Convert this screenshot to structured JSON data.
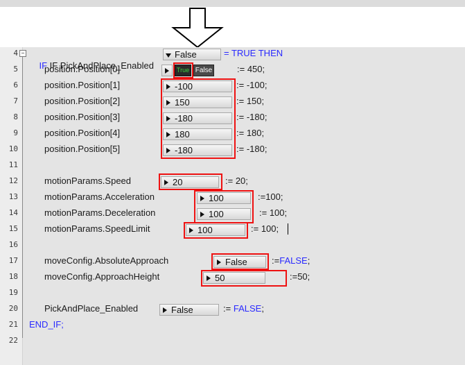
{
  "arrow_icon": "down-arrow-icon",
  "line_numbers": [
    "4",
    "5",
    "6",
    "7",
    "8",
    "9",
    "10",
    "11",
    "12",
    "13",
    "14",
    "15",
    "16",
    "17",
    "18",
    "19",
    "20",
    "21",
    "22"
  ],
  "lines": {
    "l4": {
      "pre": "IF PickAndPlace_Enabled",
      "value": "False",
      "post": "= TRUE THEN"
    },
    "l5": {
      "pre": "position.Position[0]",
      "true_label": "True",
      "false_label": "False",
      "post": ":= 450;"
    },
    "l6": {
      "pre": "position.Position[1]",
      "value": "-100",
      "post": ":= -100;"
    },
    "l7": {
      "pre": "position.Position[2]",
      "value": "150",
      "post": ":= 150;"
    },
    "l8": {
      "pre": "position.Position[3]",
      "value": "-180",
      "post": ":= -180;"
    },
    "l9": {
      "pre": "position.Position[4]",
      "value": "180",
      "post": ":= 180;"
    },
    "l10": {
      "pre": "position.Position[5]",
      "value": "-180",
      "post": ":= -180;"
    },
    "l12": {
      "pre": "motionParams.Speed",
      "value": "20",
      "post": ":= 20;"
    },
    "l13": {
      "pre": "motionParams.Acceleration",
      "value": "100",
      "post": ":=100;"
    },
    "l14": {
      "pre": "motionParams.Deceleration",
      "value": "100",
      "post": ":= 100;"
    },
    "l15": {
      "pre": "motionParams.SpeedLimit",
      "value": "100",
      "post": ":= 100;"
    },
    "l17": {
      "pre": "moveConfig.AbsoluteApproach",
      "value": "False",
      "post_op": ":=",
      "post_kw": "FALSE",
      "post_end": ";"
    },
    "l18": {
      "pre": "moveConfig.ApproachHeight",
      "value": "50",
      "post": ":=50;"
    },
    "l20": {
      "pre": "PickAndPlace_Enabled",
      "value": "False",
      "post_op": ":=",
      "post_kw": "FALSE",
      "post_end": ";"
    },
    "l21": {
      "pre": "END_IF;"
    }
  },
  "colors": {
    "keyword": "#2a2aff",
    "highlight": "#e11111",
    "editor_bg": "#e4e4e4"
  }
}
